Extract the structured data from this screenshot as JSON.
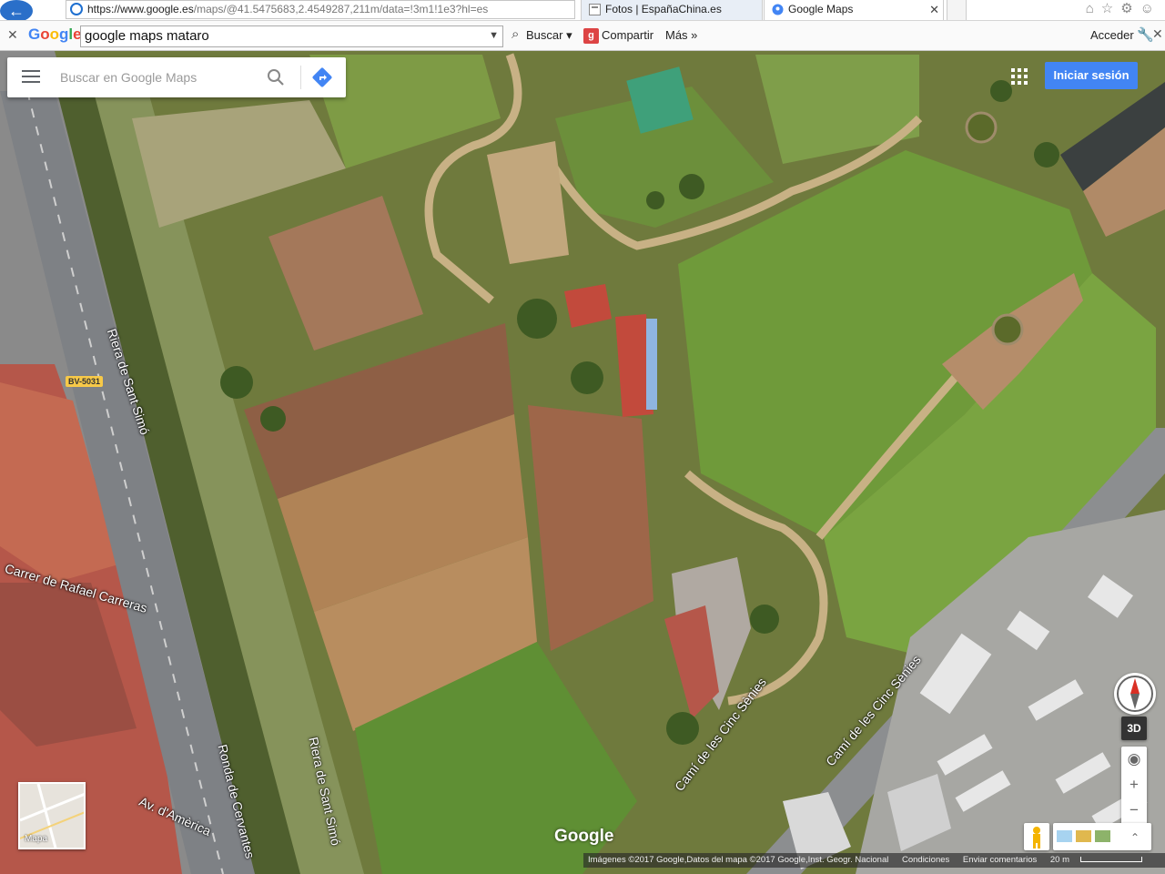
{
  "browser": {
    "url": "https://www.google.es/maps/@41.5475683,2.4549287,211m/data=!3m1!1e3?hl=es",
    "url_host": "https://www.google.es",
    "url_rest": "/maps/@41.5475683,2.4549287,211m/data=!3m1!1e3?hl=es",
    "tabs": [
      {
        "label": "Fotos | EspañaChina.es"
      },
      {
        "label": "Google Maps"
      }
    ]
  },
  "google_toolbar": {
    "logo": "Google",
    "query": "google maps mataro",
    "buscar": "Buscar",
    "compartir": "Compartir",
    "mas": "Más",
    "acceder": "Acceder"
  },
  "maps": {
    "search_placeholder": "Buscar en Google Maps",
    "signin_label": "Iniciar sesión",
    "minimap_label": "Mapa",
    "logo": "Google",
    "btn_3d": "3D",
    "zoom_in": "+",
    "zoom_out": "−",
    "attribution": {
      "imagery": "Imágenes ©2017 Google,Datos del mapa ©2017 Google,Inst. Geogr. Nacional",
      "terms": "Condiciones",
      "feedback": "Enviar comentarios",
      "scale": "20 m"
    },
    "street_labels": [
      "Riera de Sant Simó",
      "Carrer de Rafael Carreras",
      "Ronda de Cervantes",
      "Riera de Sant Simó",
      "Av. d'Amèrica",
      "Camí de les Cinc Sènies",
      "Camí de les Cinc Sènies"
    ],
    "road_shield": "BV-5031"
  }
}
